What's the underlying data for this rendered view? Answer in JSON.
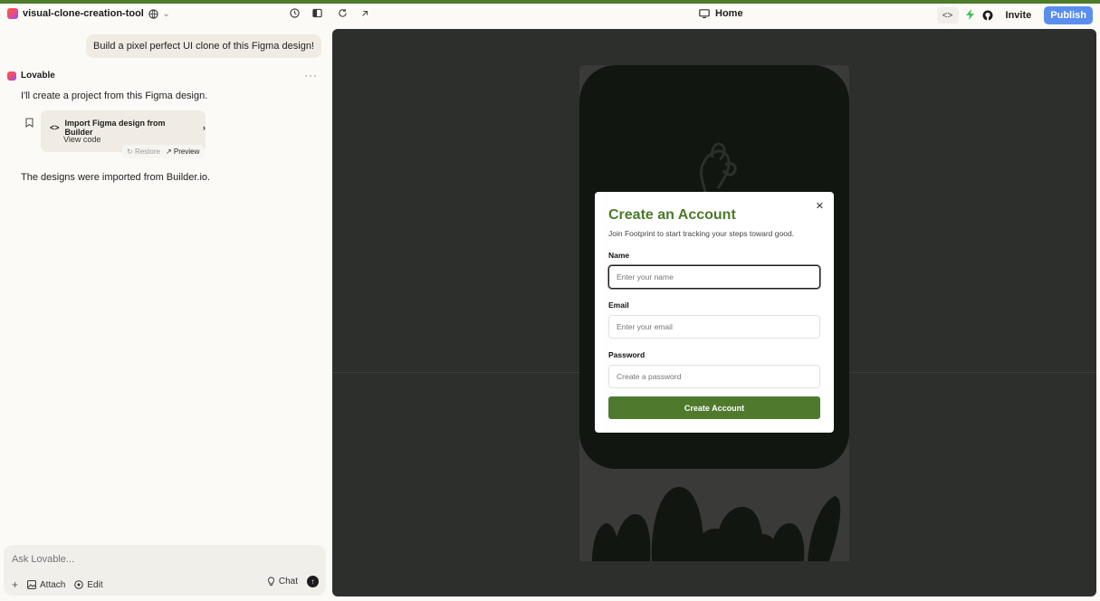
{
  "project": {
    "name": "visual-clone-creation-tool"
  },
  "toolbar": {
    "page_label": "Home",
    "invite_label": "Invite",
    "publish_label": "Publish"
  },
  "chat": {
    "user_message": "Build a pixel perfect UI clone of this Figma design!",
    "assistant_name": "Lovable",
    "assistant_intro": "I'll create a project from this Figma design.",
    "card": {
      "title": "Import Figma design from Builder",
      "view_code": "View code",
      "restore_label": "Restore",
      "preview_label": "Preview"
    },
    "assistant_followup": "The designs were imported from Builder.io."
  },
  "composer": {
    "placeholder": "Ask Lovable...",
    "attach_label": "Attach",
    "edit_label": "Edit",
    "chat_label": "Chat"
  },
  "modal": {
    "title": "Create an Account",
    "subtitle": "Join Footprint to start tracking your steps toward good.",
    "name_label": "Name",
    "name_placeholder": "Enter your name",
    "email_label": "Email",
    "email_placeholder": "Enter your email",
    "password_label": "Password",
    "password_placeholder": "Create a password",
    "submit_label": "Create Account"
  },
  "colors": {
    "accent": "#4b7a29",
    "publish": "#5b8def",
    "preview_bg": "#2c2f2b",
    "phone_dark": "#121611"
  },
  "icons": [
    "globe-icon",
    "chevron-down-icon",
    "history-icon",
    "sidebar-toggle-icon",
    "refresh-icon",
    "external-link-icon",
    "monitor-icon",
    "code-icon",
    "bolt-icon",
    "github-icon",
    "more-icon",
    "bookmark-icon",
    "restore-icon",
    "plus-icon",
    "image-icon",
    "edit-icon",
    "lightbulb-icon",
    "send-icon",
    "close-icon"
  ]
}
